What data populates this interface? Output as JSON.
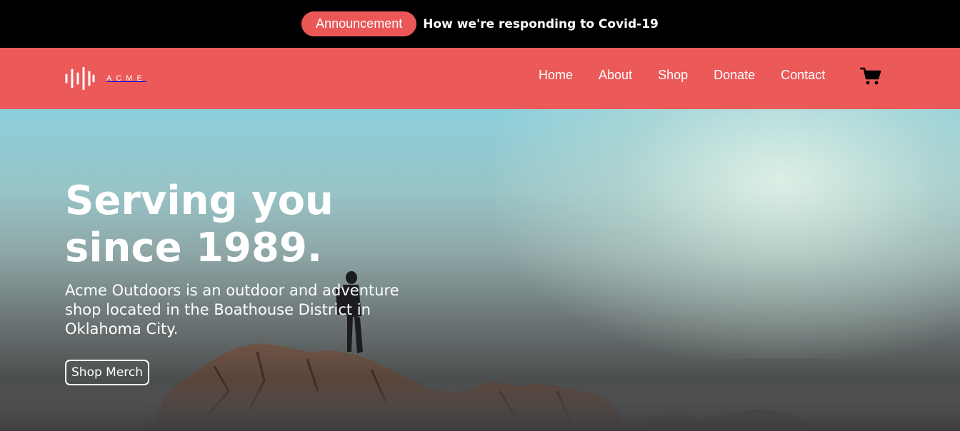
{
  "announcement": {
    "badge": "Announcement",
    "link_text": "How we're responding to Covid-19"
  },
  "header": {
    "logo_text": "ACME",
    "nav": [
      "Home",
      "About",
      "Shop",
      "Donate",
      "Contact"
    ],
    "cart_icon": "shopping-cart-icon"
  },
  "hero": {
    "title_line1": "Serving you",
    "title_line2": "since 1989.",
    "description": "Acme Outdoors is an outdoor and adventure shop located in the Boathouse District in Oklahoma City.",
    "button_label": "Shop Merch"
  },
  "colors": {
    "accent": "#eb5959",
    "announcement_bar": "#000000",
    "pill": "#eb5757"
  }
}
